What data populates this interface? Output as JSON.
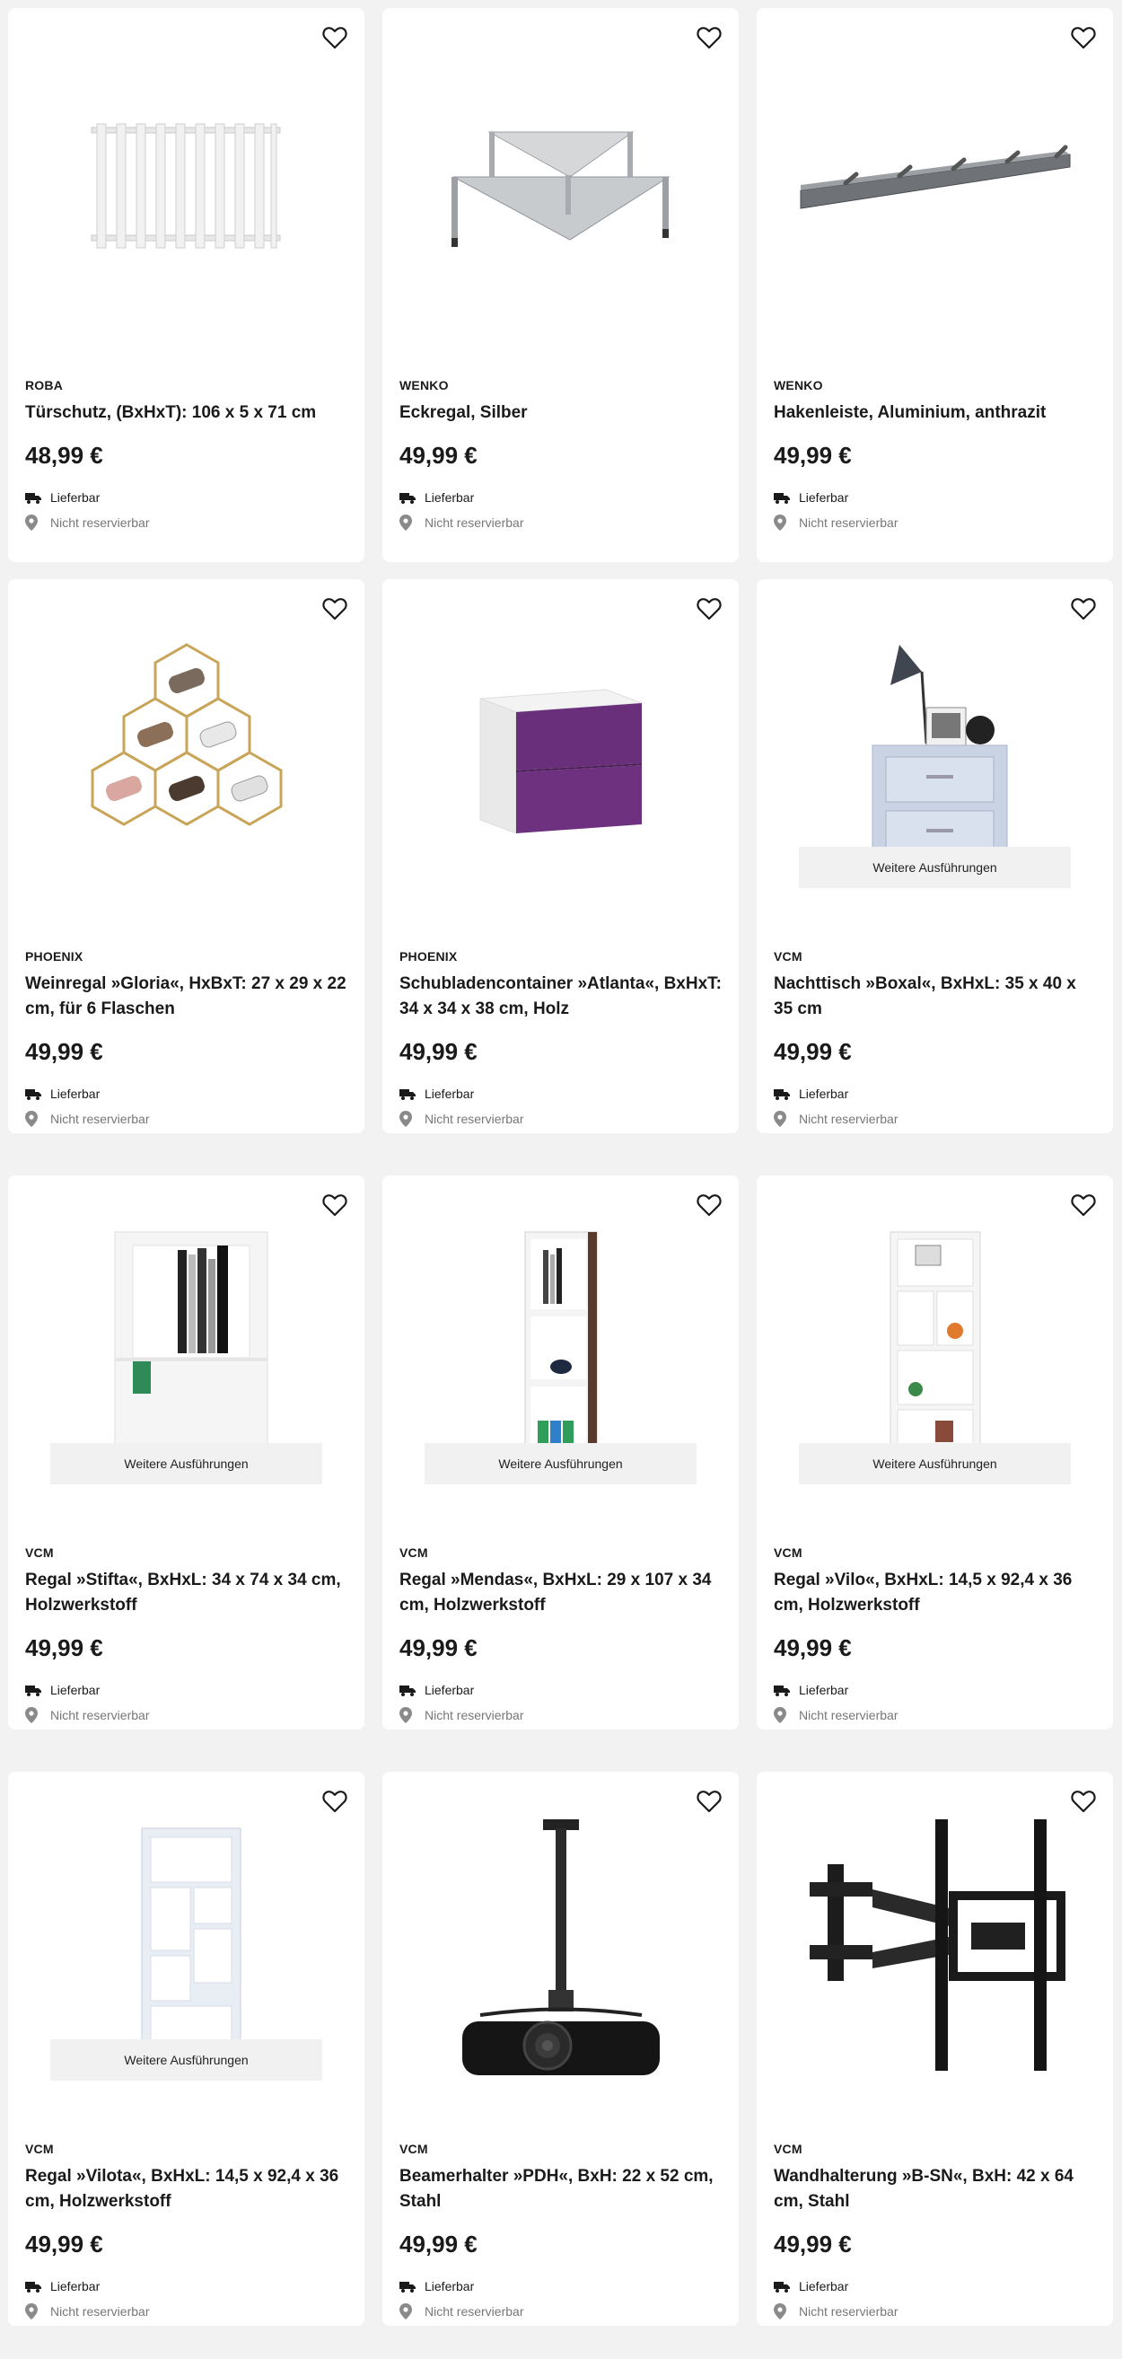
{
  "products": [
    {
      "brand": "ROBA",
      "title": "Türschutz, (BxHxT): 106 x 5 x 71 cm",
      "price": "48,99 €",
      "image": "door-gate",
      "variants": "",
      "availability": "Lieferbar",
      "reservation": "Nicht reservierbar"
    },
    {
      "brand": "WENKO",
      "title": "Eckregal, Silber",
      "price": "49,99 €",
      "image": "corner-shelf",
      "variants": "",
      "availability": "Lieferbar",
      "reservation": "Nicht reservierbar"
    },
    {
      "brand": "WENKO",
      "title": "Hakenleiste, Aluminium, anthrazit",
      "price": "49,99 €",
      "image": "hook-rail",
      "variants": "",
      "availability": "Lieferbar",
      "reservation": "Nicht reservierbar"
    },
    {
      "brand": "PHOENIX",
      "title": "Weinregal »Gloria«, HxBxT: 27 x 29 x 22 cm, für 6 Flaschen",
      "price": "49,99 €",
      "image": "wine-rack",
      "variants": "",
      "availability": "Lieferbar",
      "reservation": "Nicht reservierbar"
    },
    {
      "brand": "PHOENIX",
      "title": "Schubladencontainer »Atlanta«, BxHxT: 34 x 34 x 38 cm, Holz",
      "price": "49,99 €",
      "image": "drawer-cube",
      "variants": "",
      "availability": "Lieferbar",
      "reservation": "Nicht reservierbar"
    },
    {
      "brand": "VCM",
      "title": "Nachttisch »Boxal«, BxHxL: 35 x 40 x 35 cm",
      "price": "49,99 €",
      "image": "nightstand",
      "variants": "Weitere Ausführungen",
      "availability": "Lieferbar",
      "reservation": "Nicht reservierbar"
    },
    {
      "brand": "VCM",
      "title": "Regal »Stifta«, BxHxL: 34 x 74 x 34 cm, Holzwerkstoff",
      "price": "49,99 €",
      "image": "shelf-stifta",
      "variants": "Weitere Ausführungen",
      "availability": "Lieferbar",
      "reservation": "Nicht reservierbar"
    },
    {
      "brand": "VCM",
      "title": "Regal »Mendas«, BxHxL: 29 x 107 x 34 cm, Holzwerkstoff",
      "price": "49,99 €",
      "image": "shelf-mendas",
      "variants": "Weitere Ausführungen",
      "availability": "Lieferbar",
      "reservation": "Nicht reservierbar"
    },
    {
      "brand": "VCM",
      "title": "Regal »Vilo«, BxHxL: 14,5 x 92,4 x 36 cm, Holzwerkstoff",
      "price": "49,99 €",
      "image": "shelf-vilo",
      "variants": "Weitere Ausführungen",
      "availability": "Lieferbar",
      "reservation": "Nicht reservierbar"
    },
    {
      "brand": "VCM",
      "title": "Regal »Vilota«, BxHxL: 14,5 x 92,4 x 36 cm, Holzwerkstoff",
      "price": "49,99 €",
      "image": "shelf-vilota",
      "variants": "Weitere Ausführungen",
      "availability": "Lieferbar",
      "reservation": "Nicht reservierbar"
    },
    {
      "brand": "VCM",
      "title": "Beamerhalter »PDH«, BxH: 22 x 52 cm, Stahl",
      "price": "49,99 €",
      "image": "projector-mount",
      "variants": "",
      "availability": "Lieferbar",
      "reservation": "Nicht reservierbar"
    },
    {
      "brand": "VCM",
      "title": "Wandhalterung »B-SN«, BxH: 42 x 64 cm, Stahl",
      "price": "49,99 €",
      "image": "tv-wall-mount",
      "variants": "",
      "availability": "Lieferbar",
      "reservation": "Nicht reservierbar"
    }
  ],
  "icons": {
    "favorite": "heart-icon",
    "delivery": "truck-icon",
    "location": "pin-icon"
  },
  "colors": {
    "page_bg": "#f2f2f2",
    "card_bg": "#ffffff",
    "text": "#1a1a1a",
    "muted": "#777777",
    "variants_bg": "#f1f1f1"
  }
}
